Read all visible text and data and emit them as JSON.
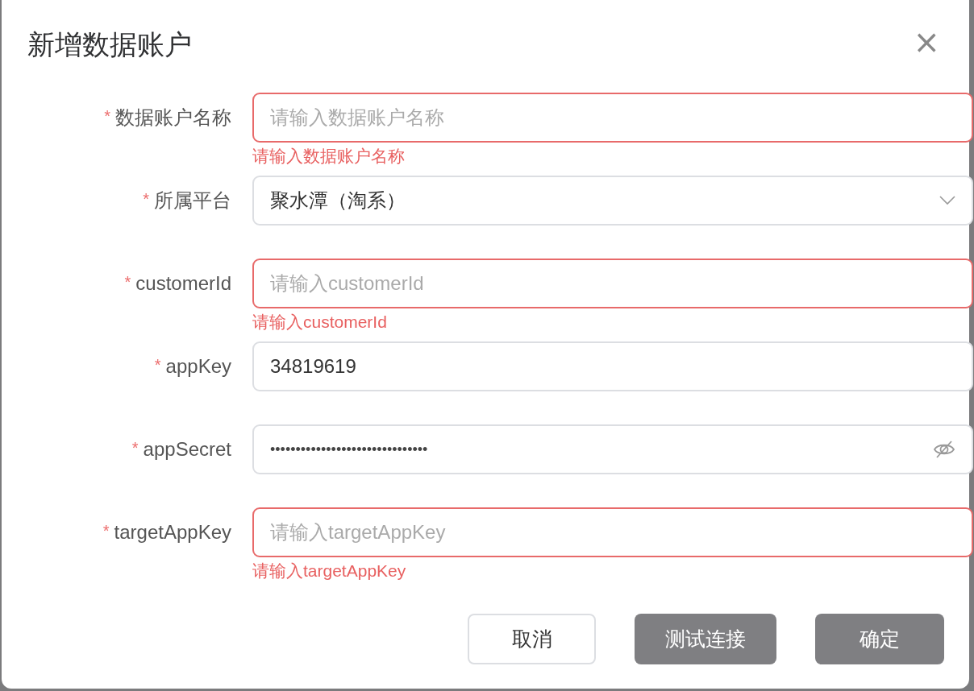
{
  "dialog": {
    "title": "新增数据账户",
    "close_label": "×"
  },
  "fields": [
    {
      "kind": "text",
      "label": "数据账户名称",
      "required_mark": "*",
      "placeholder": "请输入数据账户名称",
      "error": "请输入数据账户名称"
    },
    {
      "kind": "select",
      "label": "所属平台",
      "required_mark": "*",
      "value": "聚水潭（淘系）"
    },
    {
      "kind": "text",
      "label": "customerId",
      "required_mark": "*",
      "placeholder": "请输入customerId",
      "error": "请输入customerId"
    },
    {
      "kind": "text",
      "label": "appKey",
      "required_mark": "*",
      "value": "34819619"
    },
    {
      "kind": "password",
      "label": "appSecret",
      "required_mark": "*",
      "value": "•••••••••••••••••••••••••••••••"
    },
    {
      "kind": "text",
      "label": "targetAppKey",
      "required_mark": "*",
      "placeholder": "请输入targetAppKey",
      "error": "请输入targetAppKey"
    }
  ],
  "buttons": [
    {
      "label": "取消",
      "kind": "default"
    },
    {
      "label": "测试连接",
      "kind": "primary"
    },
    {
      "label": "确定",
      "kind": "primary"
    }
  ]
}
